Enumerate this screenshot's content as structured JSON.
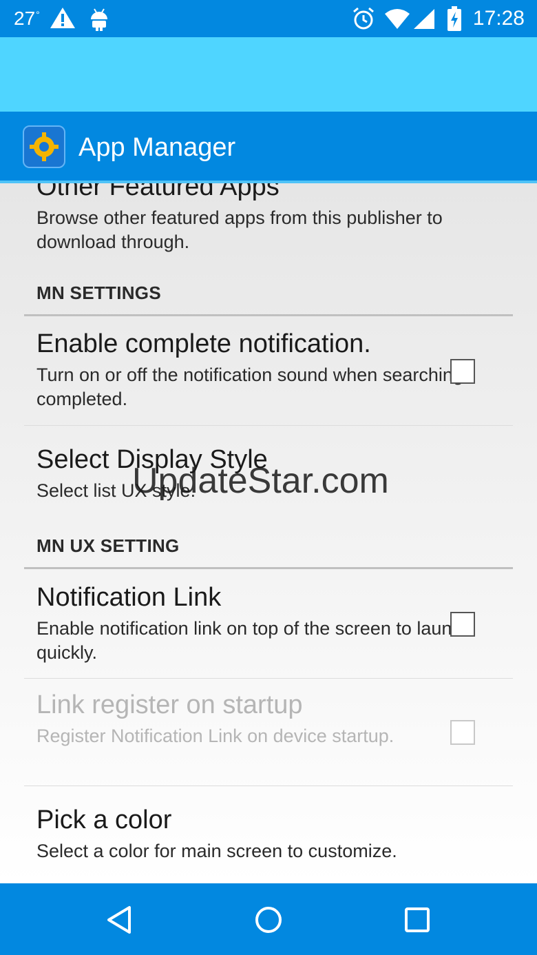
{
  "status_bar": {
    "temperature": "27",
    "degree": "°",
    "time": "17:28",
    "left_icons": [
      "warning-icon",
      "android-icon"
    ],
    "right_icons": [
      "alarm-icon",
      "wifi-icon",
      "signal-icon",
      "battery-charging-icon"
    ]
  },
  "app_bar": {
    "title": "App Manager",
    "icon": "app-manager-icon"
  },
  "settings": {
    "other_apps": {
      "title": "Other Featured Apps",
      "summary": "Browse other featured apps from this publisher to download through."
    },
    "category_mn_settings": "MN SETTINGS",
    "complete_notification": {
      "title": "Enable complete notification.",
      "summary": "Turn on or off the notification sound when searching completed.",
      "checked": false
    },
    "display_style": {
      "title": "Select Display Style",
      "summary": "Select list UX style."
    },
    "category_mn_ux": "MN UX SETTING",
    "notification_link": {
      "title": "Notification Link",
      "summary": "Enable notification link on top of the screen to launch quickly.",
      "checked": false
    },
    "link_register": {
      "title": "Link register on startup",
      "summary": "Register Notification Link on device startup.",
      "checked": false,
      "enabled": false
    },
    "pick_color": {
      "title": "Pick a color",
      "summary": "Select a color for main screen to customize."
    }
  },
  "watermark": "UpdateStar.com",
  "nav_bar": {
    "icons": [
      "back-icon",
      "home-icon",
      "recents-icon"
    ]
  },
  "colors": {
    "primary": "#0288e0",
    "accent_strip": "#4fd5ff",
    "disabled_text": "#b5b5b5"
  }
}
